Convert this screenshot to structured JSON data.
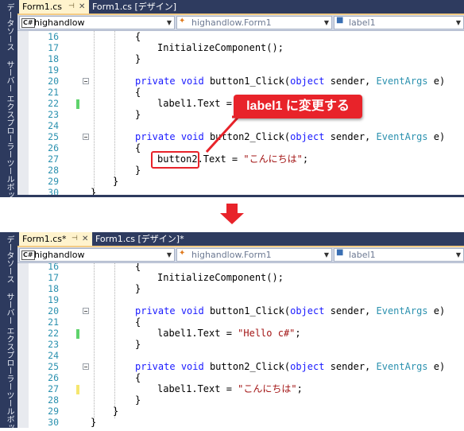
{
  "sidebar_labels": [
    "データソース",
    "サーバー エクスプローラー",
    "ツールボッ"
  ],
  "top": {
    "tabs": [
      {
        "label": "Form1.cs",
        "pin": "⊣",
        "close": "✕",
        "active": true
      },
      {
        "label": "Form1.cs [デザイン]",
        "active": false
      }
    ],
    "nav": {
      "project": "highandlow",
      "class": "highandlow.Form1",
      "member": "label1"
    },
    "line_numbers": [
      "16",
      "17",
      "18",
      "19",
      "20",
      "21",
      "22",
      "23",
      "24",
      "25",
      "26",
      "27",
      "28",
      "29",
      "30"
    ],
    "code": {
      "open_brace": "{",
      "close_brace": "}",
      "initialize": "InitializeComponent();",
      "private": "private",
      "void": "void",
      "button1_click": "button1_Click(",
      "object": "object",
      "sender": " sender, ",
      "eventargs": "EventArgs",
      "e_close": " e)",
      "label1_text_prefix": "label1.Text =",
      "button2_click": "button2_Click(",
      "button2": "button2",
      "button2_rest": ".Text = ",
      "string_jp": "\"こんにちは\"",
      "semicolon": ";"
    },
    "callout": "label1 に変更する",
    "highlight_color": "#e8232a"
  },
  "bottom": {
    "tabs": [
      {
        "label": "Form1.cs*",
        "pin": "⊣",
        "close": "✕",
        "active": true
      },
      {
        "label": "Form1.cs [デザイン]*",
        "active": false
      }
    ],
    "nav": {
      "project": "highandlow",
      "class": "highandlow.Form1",
      "member": "label1"
    },
    "line_numbers": [
      "16",
      "17",
      "18",
      "19",
      "20",
      "21",
      "22",
      "23",
      "24",
      "25",
      "26",
      "27",
      "28",
      "29",
      "30"
    ],
    "code": {
      "open_brace": "{",
      "close_brace": "}",
      "initialize": "InitializeComponent();",
      "private": "private",
      "void": "void",
      "button1_click": "button1_Click(",
      "object": "object",
      "sender": " sender, ",
      "eventargs": "EventArgs",
      "e_close": " e)",
      "label1_text": "label1.Text = ",
      "hello": "\"Hello c#\"",
      "button2_click": "button2_Click(",
      "string_jp": "\"こんにちは\"",
      "semicolon": ";"
    }
  },
  "colors": {
    "keyword": "#1a1aff",
    "type": "#2b91af",
    "string": "#a31515",
    "linenumber": "#2b91af",
    "tab_active": "#fff3cd",
    "tab_bar": "#2e3b5f",
    "change_saved": "#5fd36c",
    "change_unsaved": "#f5e66f",
    "arrow": "#e8232a"
  }
}
